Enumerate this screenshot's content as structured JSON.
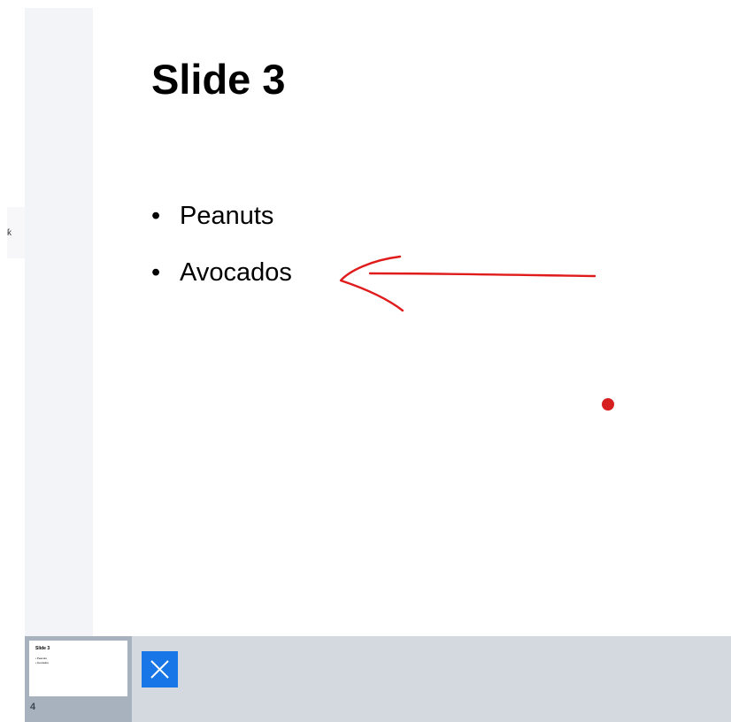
{
  "slide": {
    "title": "Slide 3",
    "bullets": [
      "Peanuts",
      "Avocados"
    ],
    "bullet_glyph": "•"
  },
  "annotations": {
    "ink_color": "#e01b1b",
    "laser_dot_color": "#d62020"
  },
  "side_tab": {
    "glyph": "ƙ"
  },
  "filmstrip": {
    "thumbnails": [
      {
        "number": "4",
        "title": "Slide 3",
        "bullets": [
          "• Peanuts",
          "• Avocados"
        ]
      }
    ],
    "close_icon": "close-icon",
    "accent_color": "#1976e6"
  }
}
